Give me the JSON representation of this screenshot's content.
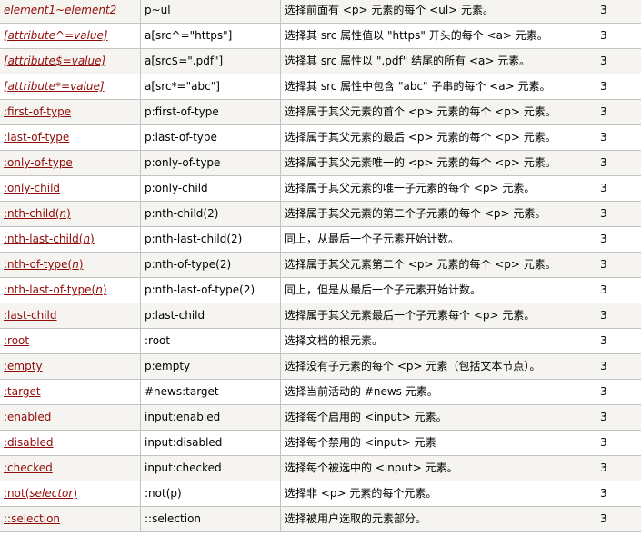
{
  "rows": [
    {
      "selector": [
        {
          "t": "element1~element2",
          "i": true
        }
      ],
      "example": "p~ul",
      "description": "选择前面有 <p> 元素的每个 <ul> 元素。",
      "version": "3"
    },
    {
      "selector": [
        {
          "t": "[attribute^=value]",
          "i": true
        }
      ],
      "example": "a[src^=\"https\"]",
      "description": "选择其 src 属性值以 \"https\" 开头的每个 <a> 元素。",
      "version": "3"
    },
    {
      "selector": [
        {
          "t": "[attribute$=value]",
          "i": true
        }
      ],
      "example": "a[src$=\".pdf\"]",
      "description": "选择其 src 属性以 \".pdf\" 结尾的所有 <a> 元素。",
      "version": "3"
    },
    {
      "selector": [
        {
          "t": "[attribute*=value]",
          "i": true
        }
      ],
      "example": "a[src*=\"abc\"]",
      "description": "选择其 src 属性中包含 \"abc\" 子串的每个 <a> 元素。",
      "version": "3"
    },
    {
      "selector": [
        {
          "t": ":first-of-type",
          "i": false
        }
      ],
      "example": "p:first-of-type",
      "description": "选择属于其父元素的首个 <p> 元素的每个 <p> 元素。",
      "version": "3"
    },
    {
      "selector": [
        {
          "t": ":last-of-type",
          "i": false
        }
      ],
      "example": "p:last-of-type",
      "description": "选择属于其父元素的最后 <p> 元素的每个 <p> 元素。",
      "version": "3"
    },
    {
      "selector": [
        {
          "t": ":only-of-type",
          "i": false
        }
      ],
      "example": "p:only-of-type",
      "description": "选择属于其父元素唯一的 <p> 元素的每个 <p> 元素。",
      "version": "3"
    },
    {
      "selector": [
        {
          "t": ":only-child",
          "i": false
        }
      ],
      "example": "p:only-child",
      "description": "选择属于其父元素的唯一子元素的每个 <p> 元素。",
      "version": "3"
    },
    {
      "selector": [
        {
          "t": ":nth-child(",
          "i": false
        },
        {
          "t": "n",
          "i": true
        },
        {
          "t": ")",
          "i": false
        }
      ],
      "example": "p:nth-child(2)",
      "description": "选择属于其父元素的第二个子元素的每个 <p> 元素。",
      "version": "3"
    },
    {
      "selector": [
        {
          "t": ":nth-last-child(",
          "i": false
        },
        {
          "t": "n",
          "i": true
        },
        {
          "t": ")",
          "i": false
        }
      ],
      "example": "p:nth-last-child(2)",
      "description": "同上，从最后一个子元素开始计数。",
      "version": "3"
    },
    {
      "selector": [
        {
          "t": ":nth-of-type(",
          "i": false
        },
        {
          "t": "n",
          "i": true
        },
        {
          "t": ")",
          "i": false
        }
      ],
      "example": "p:nth-of-type(2)",
      "description": "选择属于其父元素第二个 <p> 元素的每个 <p> 元素。",
      "version": "3"
    },
    {
      "selector": [
        {
          "t": ":nth-last-of-type(",
          "i": false
        },
        {
          "t": "n",
          "i": true
        },
        {
          "t": ")",
          "i": false
        }
      ],
      "example": "p:nth-last-of-type(2)",
      "description": "同上，但是从最后一个子元素开始计数。",
      "version": "3"
    },
    {
      "selector": [
        {
          "t": ":last-child",
          "i": false
        }
      ],
      "example": "p:last-child",
      "description": "选择属于其父元素最后一个子元素每个 <p> 元素。",
      "version": "3"
    },
    {
      "selector": [
        {
          "t": ":root",
          "i": false
        }
      ],
      "example": ":root",
      "description": "选择文档的根元素。",
      "version": "3"
    },
    {
      "selector": [
        {
          "t": ":empty",
          "i": false
        }
      ],
      "example": "p:empty",
      "description": "选择没有子元素的每个 <p> 元素（包括文本节点）。",
      "version": "3"
    },
    {
      "selector": [
        {
          "t": ":target",
          "i": false
        }
      ],
      "example": "#news:target",
      "description": "选择当前活动的 #news 元素。",
      "version": "3"
    },
    {
      "selector": [
        {
          "t": ":enabled",
          "i": false
        }
      ],
      "example": "input:enabled",
      "description": "选择每个启用的 <input> 元素。",
      "version": "3"
    },
    {
      "selector": [
        {
          "t": ":disabled",
          "i": false
        }
      ],
      "example": "input:disabled",
      "description": "选择每个禁用的 <input> 元素",
      "version": "3"
    },
    {
      "selector": [
        {
          "t": ":checked",
          "i": false
        }
      ],
      "example": "input:checked",
      "description": "选择每个被选中的 <input> 元素。",
      "version": "3"
    },
    {
      "selector": [
        {
          "t": ":not(",
          "i": false
        },
        {
          "t": "selector",
          "i": true
        },
        {
          "t": ")",
          "i": false
        }
      ],
      "example": ":not(p)",
      "description": "选择非 <p> 元素的每个元素。",
      "version": "3"
    },
    {
      "selector": [
        {
          "t": "::selection",
          "i": false
        }
      ],
      "example": "::selection",
      "description": "选择被用户选取的元素部分。",
      "version": "3"
    }
  ],
  "colors": {
    "link": "#900b09",
    "row_alt": "#f6f4f0",
    "border": "#c3c3c3"
  }
}
